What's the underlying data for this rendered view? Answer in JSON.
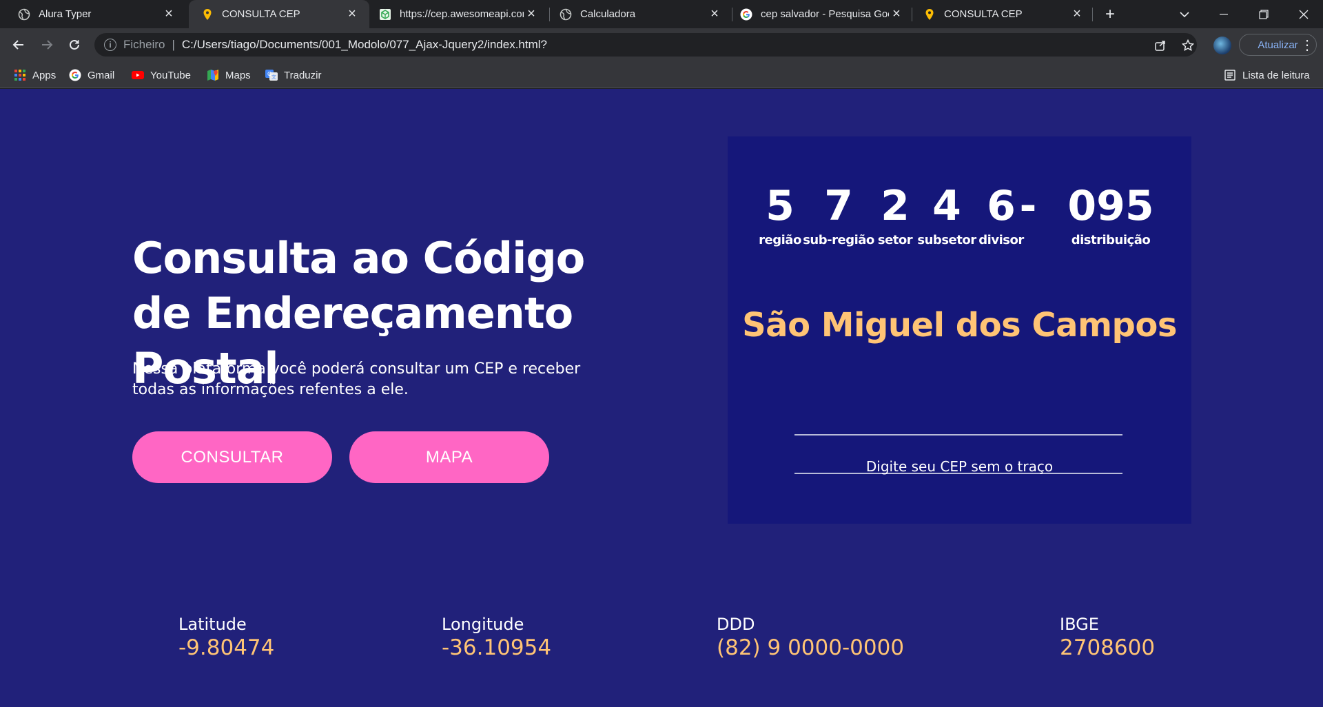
{
  "browser": {
    "tabs": [
      {
        "title": "Alura Typer",
        "icon": "globe-icon",
        "active": false
      },
      {
        "title": "CONSULTA CEP",
        "icon": "map-pin-icon",
        "active": true
      },
      {
        "title": "https://cep.awesomeapi.con",
        "icon": "api-cube-icon",
        "active": false
      },
      {
        "title": "Calculadora",
        "icon": "globe-icon",
        "active": false
      },
      {
        "title": "cep salvador - Pesquisa Goo",
        "icon": "google-icon",
        "active": false
      },
      {
        "title": "CONSULTA CEP",
        "icon": "map-pin-icon",
        "active": false
      }
    ],
    "address": {
      "scheme_label": "Ficheiro",
      "url": "C:/Users/tiago/Documents/001_Modolo/077_Ajax-Jquery2/index.html?"
    },
    "update_label": "Atualizar",
    "bookmarks": [
      {
        "label": "Apps",
        "icon": "apps-grid-icon"
      },
      {
        "label": "Gmail",
        "icon": "google-icon"
      },
      {
        "label": "YouTube",
        "icon": "youtube-icon"
      },
      {
        "label": "Maps",
        "icon": "maps-icon"
      },
      {
        "label": "Traduzir",
        "icon": "translate-icon"
      }
    ],
    "reading_list_label": "Lista de leitura"
  },
  "hero": {
    "title": "Consulta ao Código de Endereçamento Postal",
    "subtitle": "Nessa plataforma você poderá consultar um CEP e receber todas as informações refentes a ele.",
    "consult_button": "CONSULTAR",
    "map_button": "MAPA"
  },
  "cep_panel": {
    "digits": [
      {
        "value": "5",
        "label": "região"
      },
      {
        "value": "7",
        "label": "sub-região"
      },
      {
        "value": "2",
        "label": "setor"
      },
      {
        "value": "4",
        "label": "subsetor"
      },
      {
        "value": "6",
        "label": "divisor"
      },
      {
        "value": "-",
        "label": ""
      },
      {
        "value": "095",
        "label": "distribuição"
      }
    ],
    "city": "São Miguel dos Campos",
    "input_hint": "Digite seu CEP sem o traço"
  },
  "info": {
    "latitude": {
      "label": "Latitude",
      "value": "-9.80474"
    },
    "longitude": {
      "label": "Longitude",
      "value": "-36.10954"
    },
    "ddd": {
      "label": "DDD",
      "value": "(82) 9 0000-0000"
    },
    "ibge": {
      "label": "IBGE",
      "value": "2708600"
    }
  },
  "colors": {
    "page_background": "#21217a",
    "panel_background": "#15177a",
    "accent_pink": "#ff66c4",
    "accent_yellow": "#ffc475"
  }
}
